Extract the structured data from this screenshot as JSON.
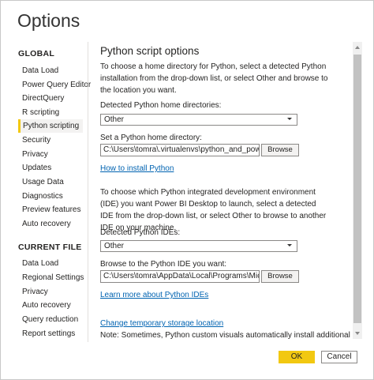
{
  "window": {
    "title": "Options"
  },
  "sidebar": {
    "global_header": "GLOBAL",
    "global_items": [
      {
        "label": "Data Load"
      },
      {
        "label": "Power Query Editor"
      },
      {
        "label": "DirectQuery"
      },
      {
        "label": "R scripting"
      },
      {
        "label": "Python scripting",
        "selected": true
      },
      {
        "label": "Security"
      },
      {
        "label": "Privacy"
      },
      {
        "label": "Updates"
      },
      {
        "label": "Usage Data"
      },
      {
        "label": "Diagnostics"
      },
      {
        "label": "Preview features"
      },
      {
        "label": "Auto recovery"
      }
    ],
    "current_header": "CURRENT FILE",
    "current_items": [
      {
        "label": "Data Load"
      },
      {
        "label": "Regional Settings"
      },
      {
        "label": "Privacy"
      },
      {
        "label": "Auto recovery"
      },
      {
        "label": "Query reduction"
      },
      {
        "label": "Report settings"
      }
    ]
  },
  "main": {
    "title": "Python script options",
    "intro": "To choose a home directory for Python, select a detected Python installation from the drop-down list, or select Other and browse to the location you want.",
    "home_dirs_label": "Detected Python home directories:",
    "home_dirs_value": "Other",
    "home_dir_label": "Set a Python home directory:",
    "home_dir_path": "C:\\Users\\tomra\\.virtualenvs\\python_and_powerbi-(",
    "browse_label": "Browse",
    "install_link": "How to install Python",
    "ide_intro": "To choose which Python integrated development environment (IDE) you want Power BI Desktop to launch, select a detected IDE from the drop-down list, or select Other to browse to another IDE on your machine.",
    "ide_label": "Detected Python IDEs:",
    "ide_value": "Other",
    "ide_path_label": "Browse to the Python IDE you want:",
    "ide_path": "C:\\Users\\tomra\\AppData\\Local\\Programs\\Microso",
    "browse_label_2": "Browse",
    "ide_link": "Learn more about Python IDEs",
    "storage_link": "Change temporary storage location",
    "note": "Note: Sometimes, Python custom visuals automatically install additional"
  },
  "footer": {
    "ok": "OK",
    "cancel": "Cancel"
  },
  "colors": {
    "accent": "#f2c811",
    "link": "#0063b1"
  }
}
